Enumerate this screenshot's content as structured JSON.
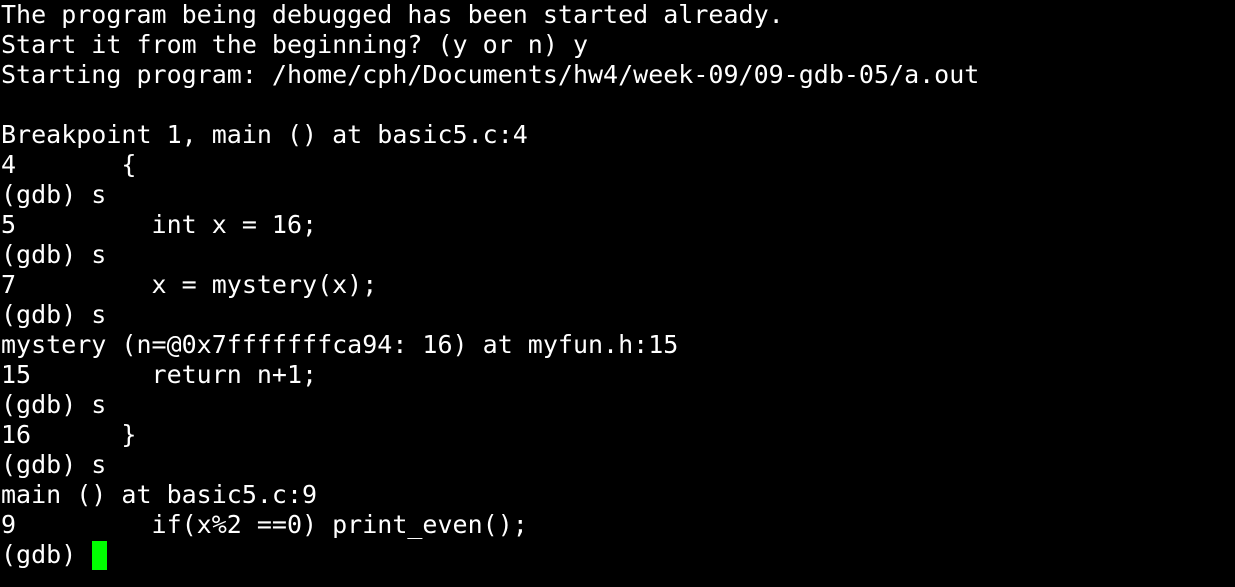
{
  "terminal": {
    "lines": [
      "The program being debugged has been started already.",
      "Start it from the beginning? (y or n) y",
      "Starting program: /home/cph/Documents/hw4/week-09/09-gdb-05/a.out",
      "",
      "Breakpoint 1, main () at basic5.c:4",
      "4       {",
      "(gdb) s",
      "5         int x = 16;",
      "(gdb) s",
      "7         x = mystery(x);",
      "(gdb) s",
      "mystery (n=@0x7fffffffca94: 16) at myfun.h:15",
      "15        return n+1;",
      "(gdb) s",
      "16      }",
      "(gdb) s",
      "main () at basic5.c:9",
      "9         if(x%2 ==0) print_even();"
    ],
    "prompt": "(gdb) ",
    "cursor_color": "#00ff00",
    "background_color": "#000000",
    "text_color": "#ffffff"
  }
}
